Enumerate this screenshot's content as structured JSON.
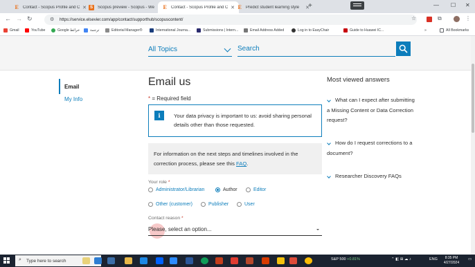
{
  "browser": {
    "tabs": [
      {
        "title": "Contact - Scopus Profile and C",
        "favicon": "E",
        "active": false
      },
      {
        "title": "Scopus preview - Scopus - We",
        "favicon": "S",
        "active": false
      },
      {
        "title": "Contact - Scopus Profile and C",
        "favicon": "E",
        "active": true
      },
      {
        "title": "Predict student learning style",
        "favicon": "E",
        "active": false
      }
    ],
    "url": "https://service.elsevier.com/app/contact/supporthub/scopuscontent/",
    "bookmarks": [
      {
        "label": "Gmail",
        "color": "#ea4335"
      },
      {
        "label": "YouTube",
        "color": "#ff0000"
      },
      {
        "label": "Google خرائط",
        "color": "#34a853"
      },
      {
        "label": "ترجمة",
        "color": "#4285f4"
      },
      {
        "label": "Editorial Manager®",
        "color": "#8a8a8a"
      },
      {
        "label": "International Journa...",
        "color": "#1a3d7c"
      },
      {
        "label": "Submissions | Intern...",
        "color": "#2b2b6e"
      },
      {
        "label": "Email Address Added",
        "color": "#777777"
      },
      {
        "label": "Log in to EasyChair",
        "color": "#333333"
      },
      {
        "label": "Guide to Huawei IC...",
        "color": "#c7000b"
      }
    ],
    "all_bookmarks": "All Bookmarks"
  },
  "searchbar": {
    "topics_label": "All Topics",
    "search_placeholder": "Search"
  },
  "sidenav": {
    "items": [
      {
        "label": "Email",
        "active": true
      },
      {
        "label": "My Info",
        "active": false
      }
    ]
  },
  "form": {
    "heading": "Email us",
    "required_star": "*",
    "required_text": "= Required field",
    "privacy_icon": "i",
    "privacy_text": "Your data privacy is important to us: avoid sharing personal details other than those requested.",
    "note_text": "For information on the next steps and timelines involved in the correction process, please see this ",
    "note_link": "FAQ",
    "note_end": ".",
    "role_label": "Your role",
    "roles": [
      {
        "label": "Administrator/Librarian",
        "checked": false
      },
      {
        "label": "Author",
        "checked": true
      },
      {
        "label": "Editor",
        "checked": false
      },
      {
        "label": "Other (customer)",
        "checked": false
      },
      {
        "label": "Publisher",
        "checked": false
      },
      {
        "label": "User",
        "checked": false
      }
    ],
    "reason_label": "Contact reason",
    "reason_value": "Please, select an option..."
  },
  "most_viewed": {
    "title": "Most viewed answers",
    "items": [
      "What can I expect after submitting a Missing Content or Data Correction request?",
      "How do I request corrections to a document?",
      "Researcher Discovery FAQs"
    ]
  },
  "taskbar": {
    "search_placeholder": "Type here to search",
    "stock": "S&P 500",
    "stock_change": "+0.81%",
    "lang": "ENG",
    "time": "8:35 PM",
    "date": "4/27/2024"
  },
  "colors": {
    "accent": "#0c7dbb",
    "required": "#c83727"
  }
}
